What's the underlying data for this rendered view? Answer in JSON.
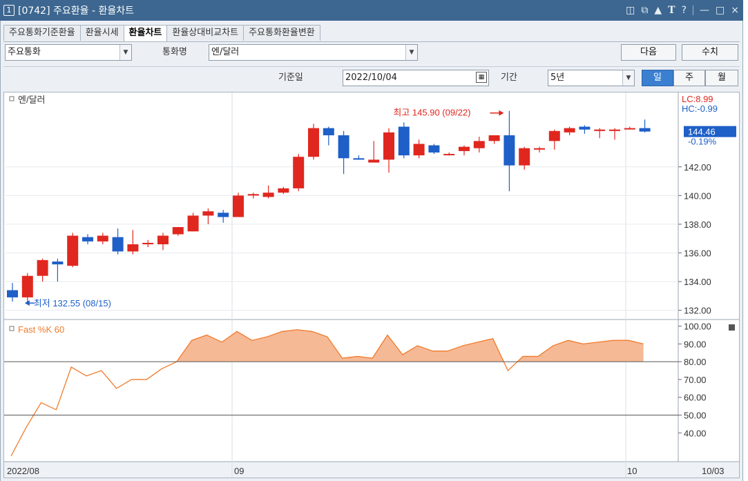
{
  "window": {
    "number": "1",
    "title": "[0742] 주요환율 - 환율차트",
    "icons": [
      "restore-icon",
      "cascade-icon",
      "lock-icon",
      "text-icon",
      "help-icon",
      "minimize-icon",
      "maximize-icon",
      "close-icon"
    ]
  },
  "tabs": [
    {
      "label": "주요통화기준환율",
      "active": false
    },
    {
      "label": "환율시세",
      "active": false
    },
    {
      "label": "환율차트",
      "active": true
    },
    {
      "label": "환율상대비교차트",
      "active": false
    },
    {
      "label": "주요통화환율변환",
      "active": false
    }
  ],
  "controls": {
    "category_value": "주요통화",
    "currency_label": "통화명",
    "currency_value": "엔/달러",
    "next_label": "다음",
    "query_label": "수치",
    "base_date_label": "기준일",
    "base_date_value": "2022/10/04",
    "period_label": "기간",
    "period_value": "5년",
    "period_buttons": [
      "일",
      "주",
      "월"
    ],
    "period_selected": "일"
  },
  "colors": {
    "up": "#e0271f",
    "down": "#1e5fc8",
    "accent": "#3b7fd0",
    "fill": "#f6b995",
    "line": "#f07a2a"
  },
  "chart_data": [
    {
      "type": "candlestick",
      "title": "엔/달러",
      "ylim": [
        131.5,
        146.8
      ],
      "yticks": [
        "142.00",
        "140.00",
        "138.00",
        "136.00",
        "134.00",
        "132.00"
      ],
      "xlabels": [
        "2022/08",
        "09",
        "10",
        "10/03"
      ],
      "high_annotation": "최고 145.90 (09/22)",
      "low_annotation": "최저 132.55 (08/15)",
      "lc_label": "LC:8.99",
      "hc_label": "HC:-0.99",
      "last_value": "144.46",
      "last_change": "-0.19%",
      "ohlc": [
        [
          133.4,
          133.9,
          132.6,
          132.9
        ],
        [
          132.9,
          134.6,
          132.55,
          134.4
        ],
        [
          134.4,
          135.6,
          134.0,
          135.5
        ],
        [
          135.4,
          135.6,
          134.0,
          135.2
        ],
        [
          135.1,
          137.4,
          135.0,
          137.2
        ],
        [
          137.1,
          137.3,
          136.6,
          136.8
        ],
        [
          136.8,
          137.4,
          136.6,
          137.2
        ],
        [
          137.1,
          137.7,
          135.9,
          136.1
        ],
        [
          136.1,
          137.6,
          135.9,
          136.6
        ],
        [
          136.6,
          136.9,
          136.4,
          136.7
        ],
        [
          136.6,
          137.4,
          136.2,
          137.2
        ],
        [
          137.3,
          137.8,
          137.2,
          137.8
        ],
        [
          137.5,
          138.8,
          137.5,
          138.6
        ],
        [
          138.6,
          139.1,
          138.0,
          138.9
        ],
        [
          138.8,
          139.0,
          138.1,
          138.5
        ],
        [
          138.5,
          140.2,
          138.5,
          140.0
        ],
        [
          140.0,
          140.2,
          139.8,
          140.1
        ],
        [
          139.9,
          140.7,
          139.8,
          140.2
        ],
        [
          140.2,
          140.6,
          140.1,
          140.5
        ],
        [
          140.5,
          142.9,
          140.3,
          142.7
        ],
        [
          142.7,
          145.0,
          142.5,
          144.7
        ],
        [
          144.7,
          144.8,
          143.5,
          144.2
        ],
        [
          144.2,
          144.5,
          141.5,
          142.6
        ],
        [
          142.6,
          142.8,
          142.5,
          142.5
        ],
        [
          142.3,
          143.8,
          142.3,
          142.5
        ],
        [
          142.5,
          144.7,
          141.6,
          144.4
        ],
        [
          144.8,
          145.1,
          142.6,
          142.8
        ],
        [
          142.8,
          143.9,
          142.6,
          143.6
        ],
        [
          143.5,
          143.6,
          142.9,
          143.0
        ],
        [
          142.9,
          143.0,
          142.8,
          142.9
        ],
        [
          143.1,
          143.5,
          142.8,
          143.4
        ],
        [
          143.3,
          144.1,
          143.0,
          143.8
        ],
        [
          143.8,
          144.2,
          143.6,
          144.2
        ],
        [
          144.2,
          145.9,
          140.3,
          142.1
        ],
        [
          142.1,
          143.4,
          141.8,
          143.3
        ],
        [
          143.2,
          143.4,
          143.0,
          143.3
        ],
        [
          143.8,
          144.6,
          143.2,
          144.5
        ],
        [
          144.4,
          144.8,
          144.2,
          144.7
        ],
        [
          144.8,
          144.9,
          144.3,
          144.6
        ],
        [
          144.5,
          144.7,
          144.0,
          144.6
        ],
        [
          144.5,
          144.7,
          143.9,
          144.6
        ],
        [
          144.7,
          144.8,
          144.6,
          144.7
        ],
        [
          144.7,
          145.3,
          144.4,
          144.46
        ]
      ]
    },
    {
      "type": "area",
      "title": "Fast %K 60",
      "ylim": [
        25,
        101
      ],
      "yticks": [
        "100.00",
        "90.00",
        "80.00",
        "70.00",
        "60.00",
        "50.00",
        "40.00"
      ],
      "reference_lines": [
        80,
        50
      ],
      "values": [
        27,
        43,
        57,
        53,
        77,
        72,
        75,
        65,
        70,
        70,
        76,
        80,
        92,
        95,
        91,
        97,
        92,
        94,
        97,
        98,
        97,
        94,
        82,
        83,
        82,
        95,
        84,
        89,
        86,
        86,
        89,
        91,
        93,
        75,
        83,
        83,
        89,
        92,
        90,
        91,
        92,
        92,
        90
      ]
    }
  ]
}
